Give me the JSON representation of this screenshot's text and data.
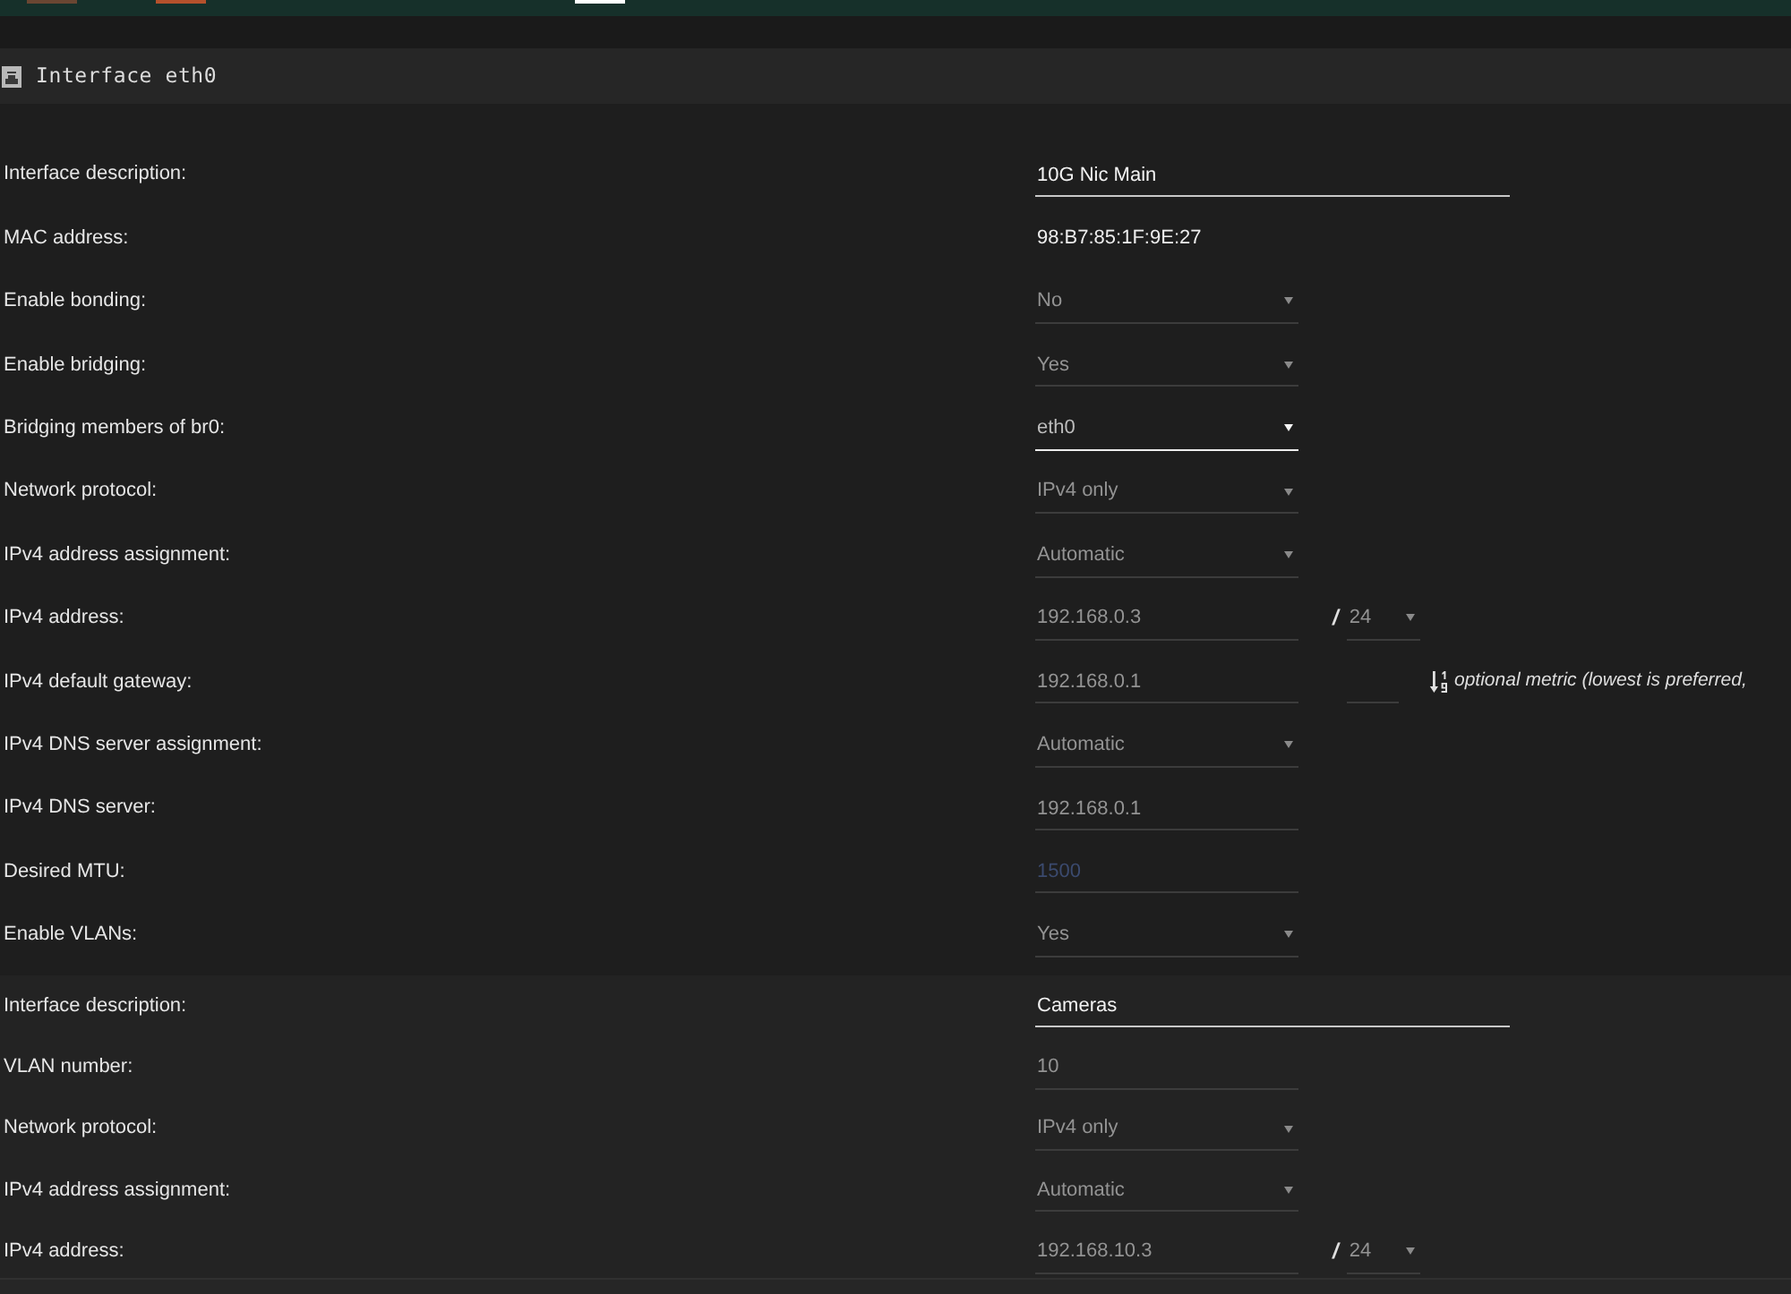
{
  "top_bar": {
    "marks": [
      {
        "color": "#6a4632"
      },
      {
        "color": "#b4512c"
      },
      {
        "color": "#ffffff"
      }
    ]
  },
  "panel": {
    "title": "Interface eth0"
  },
  "fields": [
    {
      "label": "Interface description:",
      "kind": "text",
      "value": "10G Nic Main",
      "disabled": false,
      "wide": true
    },
    {
      "label": "MAC address:",
      "kind": "static",
      "value": "98:B7:85:1F:9E:27"
    },
    {
      "label": "Enable bonding:",
      "kind": "select",
      "value": "No",
      "disabled": true
    },
    {
      "label": "Enable bridging:",
      "kind": "select",
      "value": "Yes",
      "disabled": true
    },
    {
      "label": "Bridging members of br0:",
      "kind": "select",
      "value": "eth0",
      "disabled": false
    },
    {
      "label": "Network protocol:",
      "kind": "select",
      "value": "IPv4 only",
      "disabled": true
    },
    {
      "label": "IPv4 address assignment:",
      "kind": "select",
      "value": "Automatic",
      "disabled": true
    },
    {
      "label": "IPv4 address:",
      "kind": "text",
      "value": "192.168.0.3",
      "disabled": true,
      "prefix": {
        "separator": "/",
        "value": "24",
        "disabled": true
      }
    },
    {
      "label": "IPv4 default gateway:",
      "kind": "text",
      "value": "192.168.0.1",
      "disabled": true,
      "metric": {
        "note": "optional metric (lowest is preferred,"
      }
    },
    {
      "label": "IPv4 DNS server assignment:",
      "kind": "select",
      "value": "Automatic",
      "disabled": true
    },
    {
      "label": "IPv4 DNS server:",
      "kind": "text",
      "value": "192.168.0.1",
      "disabled": true
    },
    {
      "label": "Desired MTU:",
      "kind": "text",
      "placeholder": "1500",
      "disabled": true
    },
    {
      "label": "Enable VLANs:",
      "kind": "select",
      "value": "Yes",
      "disabled": true
    }
  ],
  "vlan_fields": [
    {
      "label": "Interface description:",
      "kind": "text",
      "value": "Cameras",
      "disabled": false,
      "wide": true
    },
    {
      "label": "VLAN number:",
      "kind": "text",
      "value": "10",
      "disabled": true
    },
    {
      "label": "Network protocol:",
      "kind": "select",
      "value": "IPv4 only",
      "disabled": true
    },
    {
      "label": "IPv4 address assignment:",
      "kind": "select",
      "value": "Automatic",
      "disabled": true
    },
    {
      "label": "IPv4 address:",
      "kind": "text",
      "value": "192.168.10.3",
      "disabled": true,
      "prefix": {
        "separator": "/",
        "value": "24",
        "disabled": true
      }
    }
  ]
}
